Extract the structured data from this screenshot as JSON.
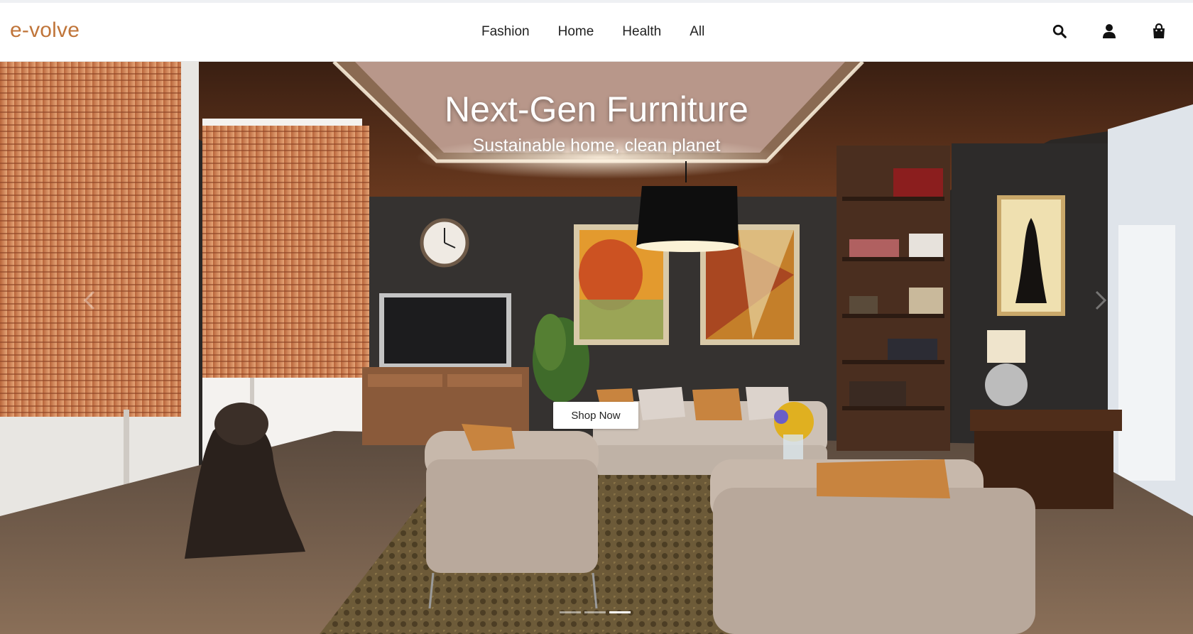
{
  "brand": {
    "logo_text": "e-volve",
    "accent_color": "#c0753a"
  },
  "nav": {
    "items": [
      {
        "label": "Fashion"
      },
      {
        "label": "Home"
      },
      {
        "label": "Health"
      },
      {
        "label": "All"
      }
    ]
  },
  "header_icons": [
    "search-icon",
    "user-icon",
    "shopping-bag-icon"
  ],
  "hero": {
    "title": "Next-Gen Furniture",
    "subtitle": "Sustainable home, clean planet",
    "cta_label": "Shop Now",
    "image_subject": "modern living room interior",
    "slide_count": 3,
    "active_slide": 3
  }
}
